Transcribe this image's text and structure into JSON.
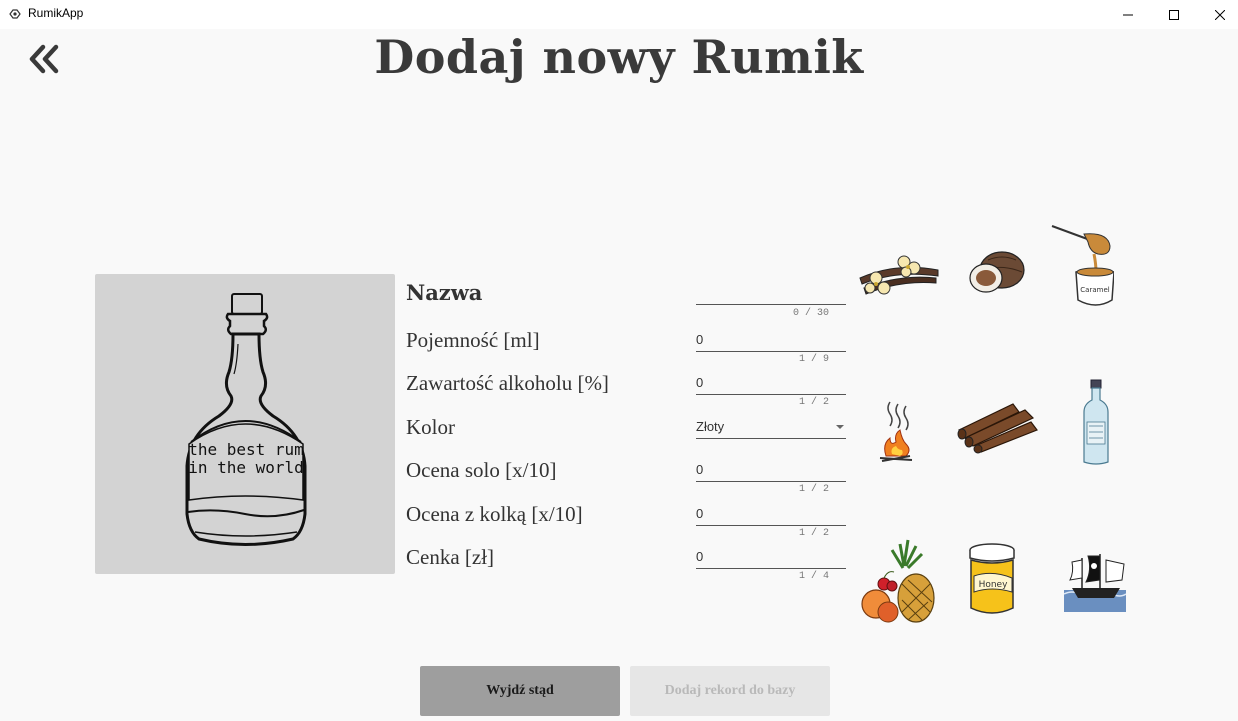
{
  "window": {
    "title": "RumikApp"
  },
  "page": {
    "title": "Dodaj nowy Rumik"
  },
  "bottle": {
    "label_line1": "the best rum",
    "label_line2": "in the world"
  },
  "form": {
    "name": {
      "label": "Nazwa",
      "value": "",
      "counter": "0 / 30"
    },
    "capacity": {
      "label": "Pojemność [ml]",
      "value": "0",
      "counter": "1 / 9"
    },
    "alcohol": {
      "label": "Zawartość alkoholu [%]",
      "value": "0",
      "counter": "1 / 2"
    },
    "color": {
      "label": "Kolor",
      "value": "Złoty"
    },
    "solo_rating": {
      "label": "Ocena solo [x/10]",
      "value": "0",
      "counter": "1 / 2"
    },
    "cola_rating": {
      "label": "Ocena z kolką [x/10]",
      "value": "0",
      "counter": "1 / 2"
    },
    "price": {
      "label": "Cenka [zł]",
      "value": "0",
      "counter": "1 / 4"
    }
  },
  "ingredients": [
    "vanilla-icon",
    "coconut-icon",
    "caramel-icon",
    "smoke-fire-icon",
    "cinnamon-icon",
    "gin-bottle-icon",
    "fruits-icon",
    "honey-icon",
    "pirate-ship-icon"
  ],
  "ingredient_labels": {
    "caramel_jar": "Caramel",
    "honey_jar": "Honey"
  },
  "buttons": {
    "exit": "Wyjdź stąd",
    "add": "Dodaj rekord do bazy"
  }
}
